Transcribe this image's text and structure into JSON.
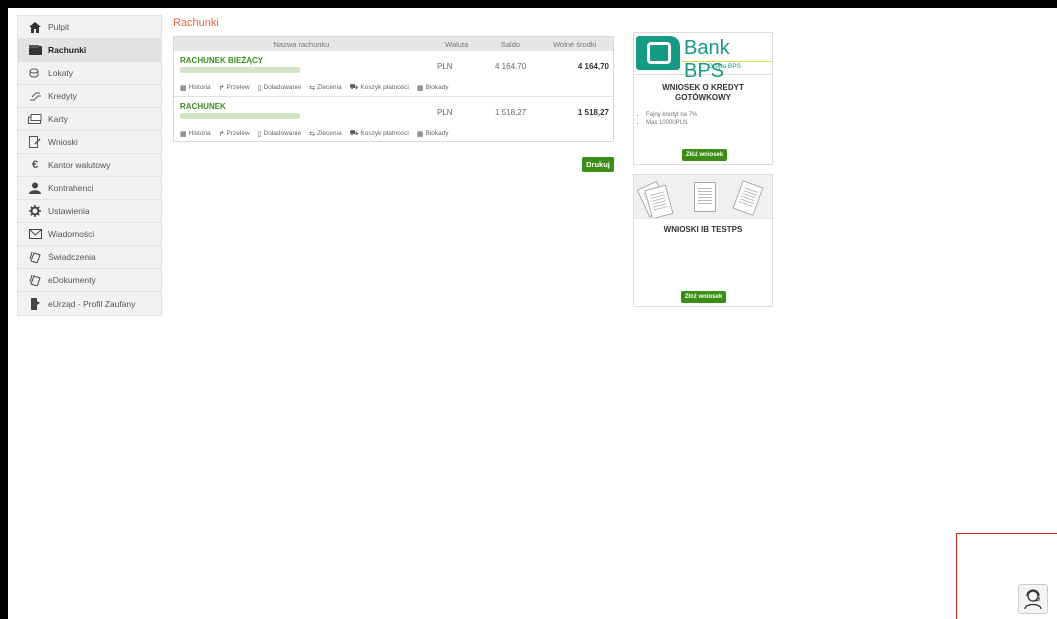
{
  "sidebar": {
    "items": [
      {
        "label": "Pulpit",
        "icon": "home-icon"
      },
      {
        "label": "Rachunki",
        "icon": "wallet-icon"
      },
      {
        "label": "Lokaty",
        "icon": "coins-icon"
      },
      {
        "label": "Kredyty",
        "icon": "loan-icon"
      },
      {
        "label": "Karty",
        "icon": "card-icon"
      },
      {
        "label": "Wnioski",
        "icon": "form-icon"
      },
      {
        "label": "Kantor walutowy",
        "icon": "euro-icon"
      },
      {
        "label": "Kontrahenci",
        "icon": "contacts-icon"
      },
      {
        "label": "Ustawienia",
        "icon": "gear-icon"
      },
      {
        "label": "Wiadomości",
        "icon": "envelope-icon"
      },
      {
        "label": "Świadczenia",
        "icon": "benefits-icon"
      },
      {
        "label": "eDokumenty",
        "icon": "documents-icon"
      },
      {
        "label": "eUrząd - Profil Zaufany",
        "icon": "eoffice-icon"
      }
    ],
    "active": "Rachunki"
  },
  "main": {
    "title": "Rachunki",
    "table": {
      "headers": {
        "name": "Nazwa rachunku",
        "currency": "Waluta",
        "balance": "Saldo",
        "available": "Wolne środki"
      },
      "rows": [
        {
          "name": "RACHUNEK BIEŻĄCY",
          "currency": "PLN",
          "balance": "4 164,70",
          "available": "4 164,70"
        },
        {
          "name": "RACHUNEK",
          "currency": "PLN",
          "balance": "1 518,27",
          "available": "1 518,27"
        }
      ],
      "actions": [
        "Historia",
        "Przelew",
        "Doładowanie",
        "Zlecenia",
        "Koszyk płatności",
        "Blokady"
      ]
    },
    "print_label": "Drukuj"
  },
  "promo": {
    "card1": {
      "bank_name": "Bank BPS",
      "bank_sub": "Grupa BPS",
      "title_line1": "WNIOSEK O KREDYT",
      "title_line2": "GOTÓWKOWY",
      "bullets": [
        "Fajny kredyt na 7%",
        "Max 10000PLN"
      ],
      "button": "Złóż wniosek"
    },
    "card2": {
      "title": "WNIOSKI IB TESTPS",
      "button": "Złóż wniosek"
    }
  },
  "colors": {
    "accent_green": "#3a8e14",
    "title_orange": "#e8663a",
    "bank_teal": "#159b83"
  }
}
